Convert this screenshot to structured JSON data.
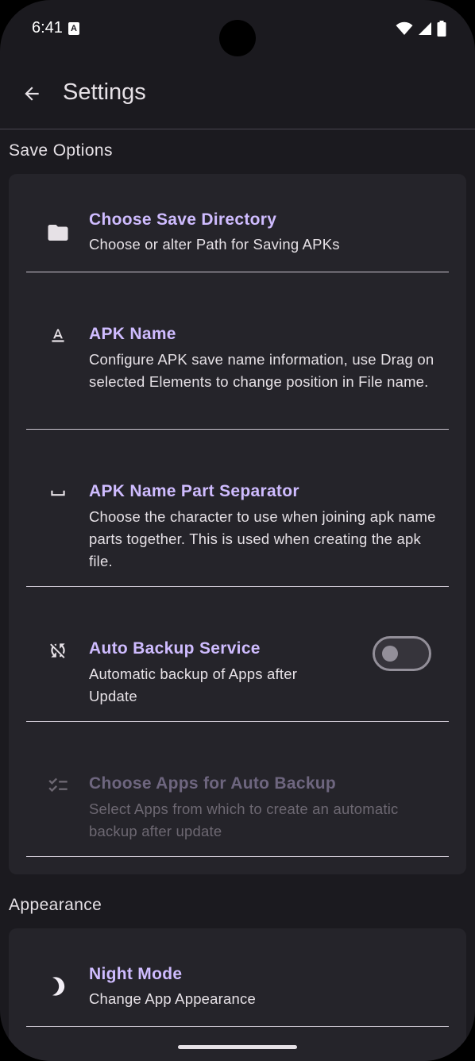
{
  "status_bar": {
    "time": "6:41",
    "notification_letter": "A",
    "icons": [
      "wifi-icon",
      "cellular-signal-icon",
      "battery-icon"
    ]
  },
  "app_bar": {
    "title": "Settings",
    "back_icon": "arrow-left-icon"
  },
  "colors": {
    "background": "#1b1a1f",
    "card": "#25242a",
    "accent": "#cfbcff",
    "disabled_title": "#6e667f"
  },
  "sections": {
    "save_options": {
      "title": "Save Options",
      "items": [
        {
          "icon": "folder-icon",
          "title": "Choose Save Directory",
          "summary": "Choose or alter Path for Saving APKs"
        },
        {
          "icon": "text-format-icon",
          "title": "APK Name",
          "summary": "Configure APK save name information, use Drag on selected Elements to change position in File name."
        },
        {
          "icon": "space-bar-icon",
          "title": "APK Name Part Separator",
          "summary": "Choose the character to use when joining apk name parts together. This is used when creating the apk file."
        },
        {
          "icon": "sync-disabled-icon",
          "title": "Auto Backup Service",
          "summary": "Automatic backup of Apps after Update",
          "switch_on": false
        },
        {
          "icon": "checklist-icon",
          "title": "Choose Apps for Auto Backup",
          "summary": "Select Apps from which to create an automatic backup after update",
          "enabled": false
        }
      ]
    },
    "appearance": {
      "title": "Appearance",
      "items": [
        {
          "icon": "moon-icon",
          "title": "Night Mode",
          "summary": "Change App Appearance"
        }
      ]
    }
  }
}
